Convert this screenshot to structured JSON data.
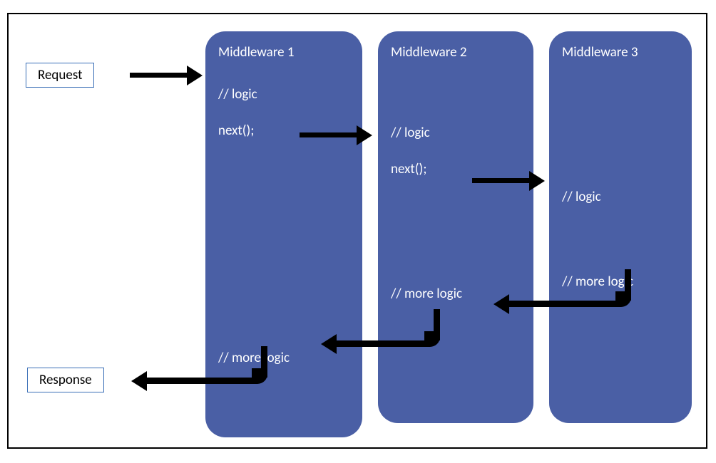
{
  "labels": {
    "request": "Request",
    "response": "Response"
  },
  "middlewares": {
    "mw1": {
      "title": "Middleware 1",
      "logic": "// logic",
      "next": "next();",
      "more_logic": "// more logic"
    },
    "mw2": {
      "title": "Middleware 2",
      "logic": "// logic",
      "next": "next();",
      "more_logic": "// more logic"
    },
    "mw3": {
      "title": "Middleware 3",
      "logic": "// logic",
      "more_logic": "// more logic"
    }
  }
}
